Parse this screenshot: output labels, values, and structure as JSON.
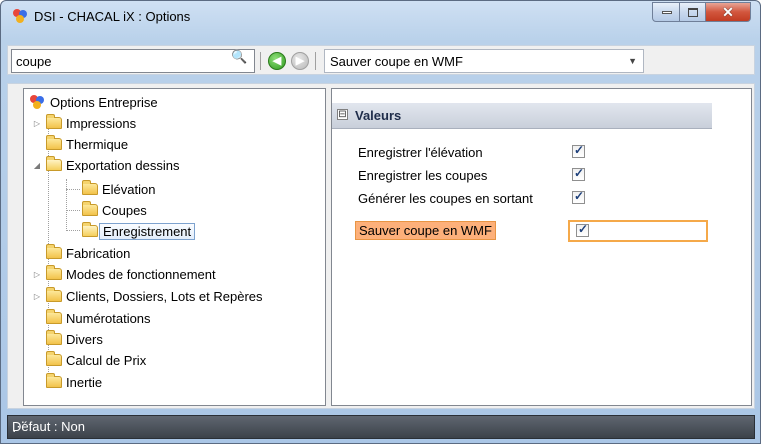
{
  "window": {
    "title": "DSI - CHACAL iX : Options"
  },
  "toolbar": {
    "search_value": "coupe",
    "selected_result": "Sauver coupe en WMF"
  },
  "tree": {
    "root": "Options Entreprise",
    "items": [
      {
        "label": "Impressions"
      },
      {
        "label": "Thermique"
      },
      {
        "label": "Exportation dessins"
      },
      {
        "label": "Elévation"
      },
      {
        "label": "Coupes"
      },
      {
        "label": "Enregistrement"
      },
      {
        "label": "Fabrication"
      },
      {
        "label": "Modes de fonctionnement"
      },
      {
        "label": "Clients, Dossiers, Lots et Repères"
      },
      {
        "label": "Numérotations"
      },
      {
        "label": "Divers"
      },
      {
        "label": "Calcul de Prix"
      },
      {
        "label": "Inertie"
      }
    ]
  },
  "properties": {
    "group_toggle": "⊟",
    "group_label": "Valeurs",
    "rows": [
      {
        "label": "Enregistrer l'élévation",
        "checked": true
      },
      {
        "label": "Enregistrer les coupes",
        "checked": true
      },
      {
        "label": "Générer les coupes en sortant",
        "checked": true
      },
      {
        "label": "Sauver coupe en WMF",
        "checked": true
      }
    ]
  },
  "status": {
    "text": "Défaut : Non"
  },
  "colors": {
    "accent": "#f5a94a",
    "selection": "#fdb07a"
  }
}
